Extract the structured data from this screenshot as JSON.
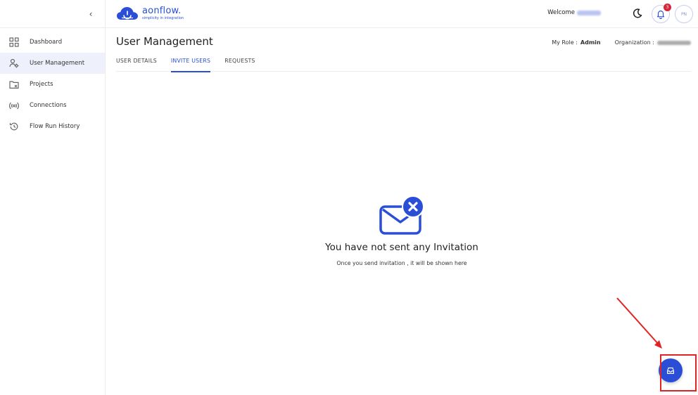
{
  "app": {
    "logo_name": "aonflow.",
    "logo_tagline": "simplicity in integration",
    "collapse_glyph": "‹"
  },
  "header": {
    "welcome_label": "Welcome",
    "notification_count": "3",
    "avatar_initials": "PN"
  },
  "sidebar": {
    "items": [
      {
        "label": "Dashboard",
        "icon": "grid-icon"
      },
      {
        "label": "User Management",
        "icon": "users-gear-icon"
      },
      {
        "label": "Projects",
        "icon": "folder-icon"
      },
      {
        "label": "Connections",
        "icon": "signal-icon"
      },
      {
        "label": "Flow Run History",
        "icon": "history-icon"
      }
    ]
  },
  "main": {
    "title": "User Management",
    "role_label": "My Role :",
    "role_value": "Admin",
    "org_label": "Organization :",
    "tabs": [
      {
        "label": "USER DETAILS"
      },
      {
        "label": "INVITE USERS",
        "active": true
      },
      {
        "label": "REQUESTS"
      }
    ],
    "empty_title": "You have not sent any Invitation",
    "empty_subtitle": "Once you send invitation , it will be shown here"
  },
  "colors": {
    "accent": "#2a4fd6",
    "badge": "#d6263a",
    "annotation": "#e02424"
  }
}
